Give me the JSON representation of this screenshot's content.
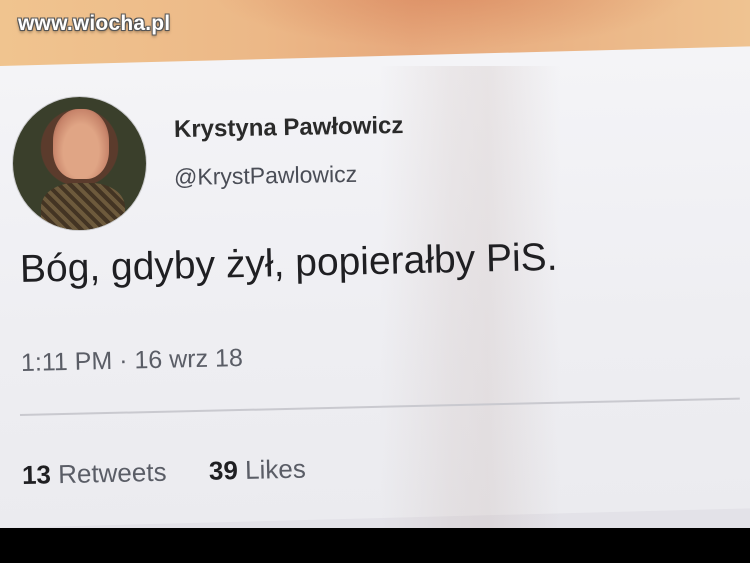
{
  "watermark": "www.wiocha.pl",
  "tweet": {
    "author_name": "Krystyna Pawłowicz",
    "author_handle": "@KrystPawlowicz",
    "text": "Bóg, gdyby żył, popierałby PiS.",
    "timestamp": "1:11 PM · 16 wrz 18",
    "retweets_count": "13",
    "retweets_label": "Retweets",
    "likes_count": "39",
    "likes_label": "Likes"
  },
  "icons": {
    "avatar": "profile-photo-icon"
  }
}
